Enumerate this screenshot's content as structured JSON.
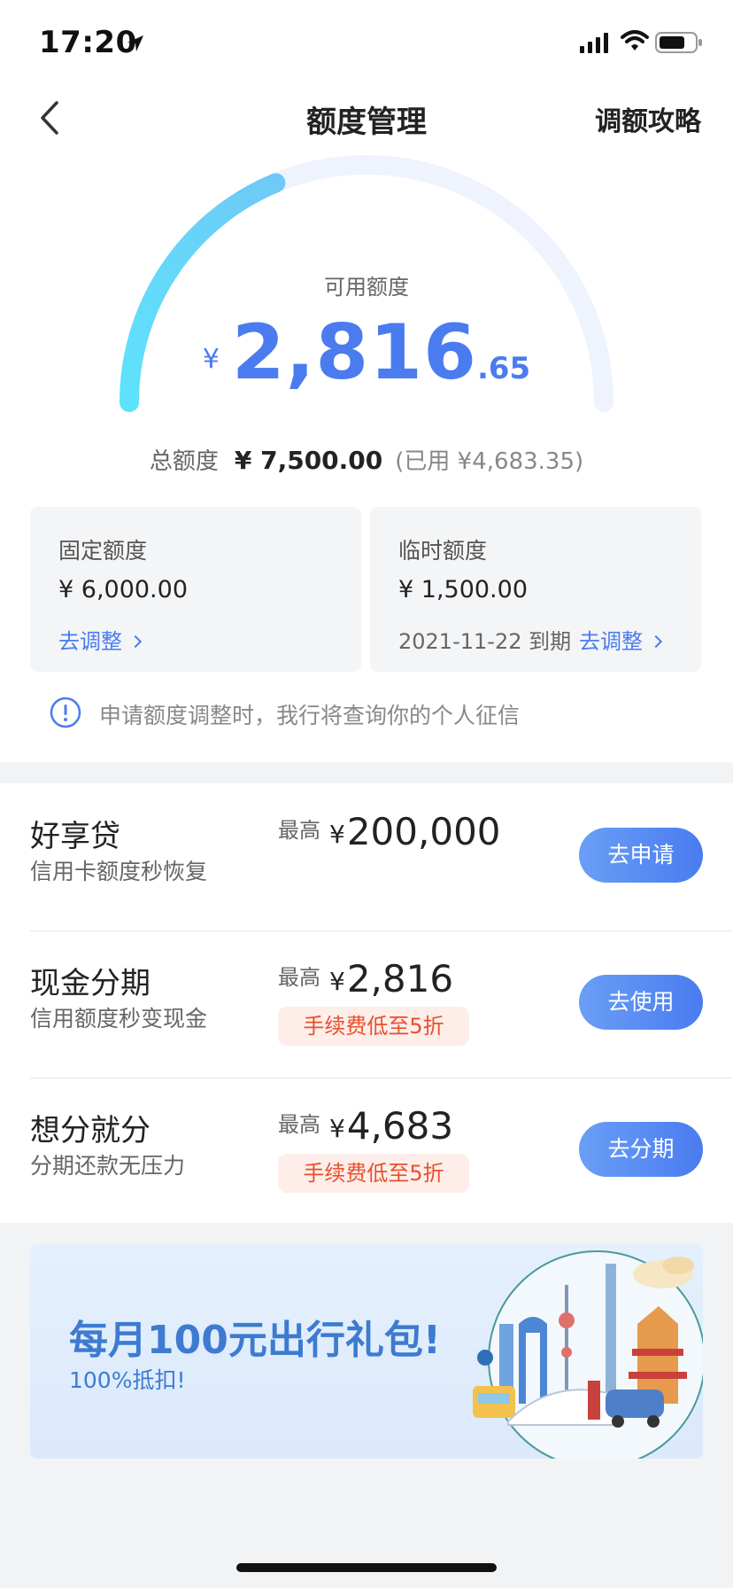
{
  "status_bar": {
    "time": "17:20"
  },
  "nav": {
    "title": "额度管理",
    "right_link": "调额攻略"
  },
  "gauge": {
    "label": "可用额度",
    "currency": "¥",
    "integer": "2,816",
    "decimal": ".65",
    "fraction_available": 0.375,
    "colors": {
      "track": "#eef3fd",
      "fill_start": "#5ee2fb",
      "fill_end": "#6fc9f6"
    }
  },
  "totals": {
    "label": "总额度",
    "total": "¥ 7,500.00",
    "used": "(已用 ¥4,683.35)"
  },
  "cards": {
    "fixed": {
      "title": "固定额度",
      "amount": "¥ 6,000.00",
      "link": "去调整"
    },
    "temp": {
      "title": "临时额度",
      "amount": "¥ 1,500.00",
      "expire": "2021-11-22 到期",
      "link": "去调整"
    }
  },
  "notice": {
    "text": "申请额度调整时，我行将查询你的个人征信"
  },
  "products": [
    {
      "name": "好享贷",
      "sub": "信用卡额度秒恢复",
      "max_label": "最高",
      "yen": "¥",
      "max_value": "200,000",
      "button": "去申请"
    },
    {
      "name": "现金分期",
      "sub": "信用额度秒变现金",
      "max_label": "最高",
      "yen": "¥",
      "max_value": "2,816",
      "tag": "手续费低至5折",
      "button": "去使用"
    },
    {
      "name": "想分就分",
      "sub": "分期还款无压力",
      "max_label": "最高",
      "yen": "¥",
      "max_value": "4,683",
      "tag": "手续费低至5折",
      "button": "去分期"
    }
  ],
  "banner": {
    "title": "每月100元出行礼包!",
    "subtitle": "100%抵扣!"
  },
  "accent_color": "#4a7cf0"
}
